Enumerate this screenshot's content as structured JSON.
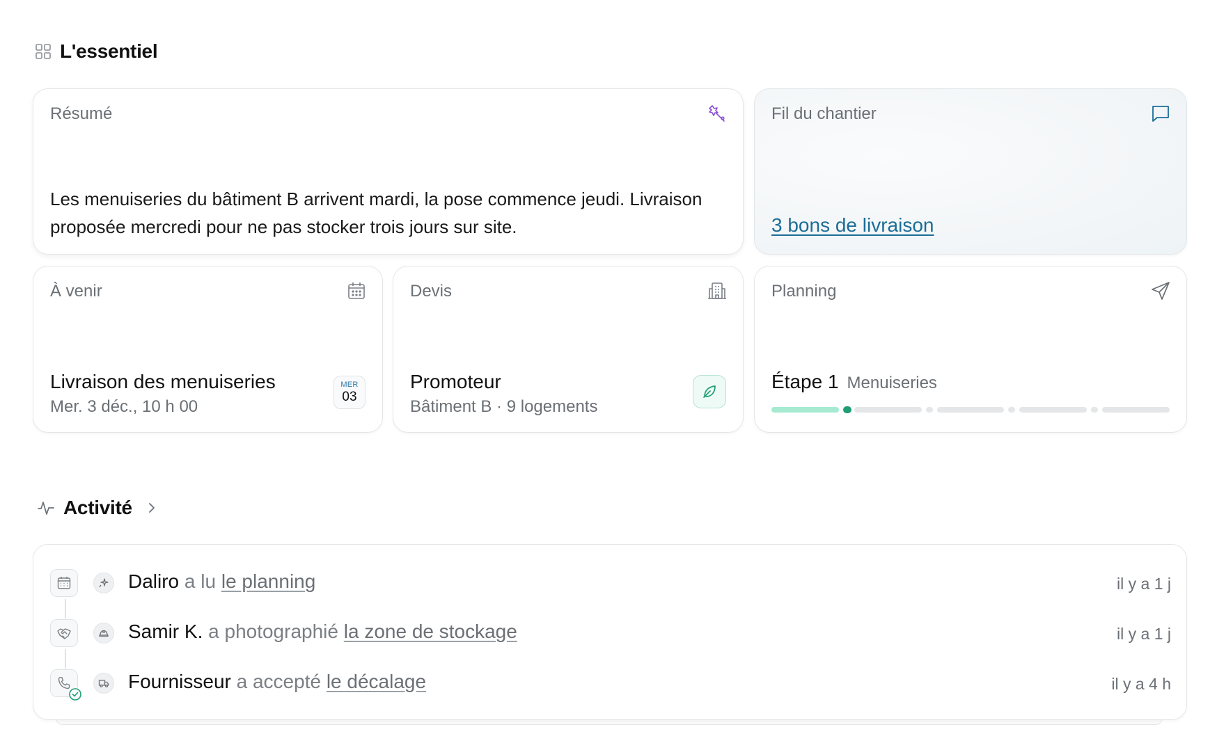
{
  "essentiel": {
    "title": "L'essentiel",
    "resume": {
      "label": "Résumé",
      "text": "Les menuiseries du bâtiment B arrivent mardi, la pose commence jeudi. Livraison proposée mercredi pour ne pas stocker trois jours sur site."
    },
    "fil": {
      "label": "Fil du chantier",
      "link": "3 bons de livraison"
    },
    "avenir": {
      "label": "À venir",
      "title": "Livraison des menuiseries",
      "subtitle": "Mer. 3 déc., 10 h 00",
      "badge_dow": "MER",
      "badge_day": "03"
    },
    "devis": {
      "label": "Devis",
      "title": "Promoteur",
      "subtitle": "Bâtiment B · 9 logements"
    },
    "planning": {
      "label": "Planning",
      "step": "Étape 1",
      "step_name": "Menuiseries",
      "current_step": 1,
      "total_steps": 5
    }
  },
  "activite": {
    "title": "Activité",
    "items": [
      {
        "actor": "Daliro",
        "verb": "a lu",
        "object": "le planning",
        "time": "il y a 1 j",
        "icon": "calendar-icon",
        "avatar": "sparkle-icon"
      },
      {
        "actor": "Samir K.",
        "verb": "a photographié",
        "object": "la zone de stockage",
        "time": "il y a 1 j",
        "icon": "handshake-icon",
        "avatar": "hardhat-icon"
      },
      {
        "actor": "Fournisseur",
        "verb": "a accepté",
        "object": "le décalage",
        "time": "il y a 4 h",
        "icon": "phone-check-icon",
        "avatar": "truck-icon"
      }
    ]
  },
  "colors": {
    "accent_blue": "#1b6d96",
    "accent_green": "#1f9d73",
    "accent_green_light": "#a6ead1",
    "accent_purple": "#8a4fd8"
  }
}
